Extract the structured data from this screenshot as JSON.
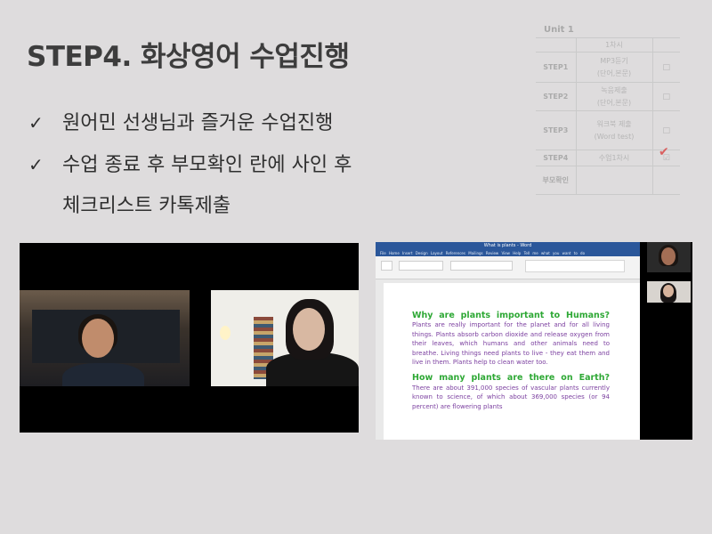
{
  "title": "STEP4.  화상영어 수업진행",
  "bullets": [
    {
      "check": "✓",
      "text": "원어민 선생님과 즐거운 수업진행"
    },
    {
      "check": "✓",
      "text": "수업 종료 후 부모확인 란에 사인 후"
    }
  ],
  "bullet_continuation": "체크리스트 카톡제출",
  "checklist": {
    "unit": "Unit 1",
    "header": "1차시",
    "rows": [
      {
        "step": "STEP1",
        "line1": "MP3듣기",
        "line2": "(단어,본문)",
        "box": "□"
      },
      {
        "step": "STEP2",
        "line1": "녹음제출",
        "line2": "(단어,본문)",
        "box": "□"
      },
      {
        "step": "STEP3",
        "line1": "워크북 제출",
        "line2": "(Word test)",
        "box": "□"
      },
      {
        "step": "STEP4",
        "line1": "수업1차시",
        "line2": "",
        "box": "☑"
      },
      {
        "step": "부모확인",
        "line1": "",
        "line2": "",
        "box": ""
      }
    ],
    "mark_color": "#d96060"
  },
  "word_doc": {
    "title_bar": "What is plants - Word",
    "tabs": "File Home Insert Design Layout References Mailings Review View Help Tell me what you want to do",
    "heading1": "Why are plants important to Humans?",
    "para1": " Plants are really important for the planet and for all living things. Plants absorb carbon dioxide and release oxygen from their leaves, which humans and other animals need to breathe. Living things need plants to live - they eat them and live in them. Plants help to clean water too.",
    "heading2": "How many plants are there on Earth?",
    "para2": " There are about 391,000 species of vascular plants currently known to science, of which about 369,000 species (or 94 percent) are flowering plants",
    "heading_color": "#2ea835",
    "text_color": "#7b3f9f",
    "title_bar_color": "#2b579a"
  }
}
